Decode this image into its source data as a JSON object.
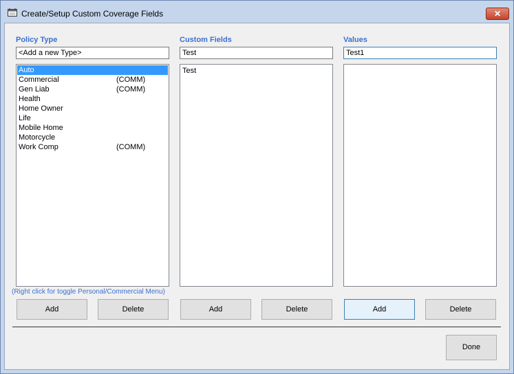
{
  "window": {
    "title": "Create/Setup Custom Coverage Fields",
    "close_glyph": "✕"
  },
  "policy_type": {
    "heading": "Policy Type",
    "input_value": "<Add a new Type>",
    "items": [
      {
        "name": "Auto",
        "tag": "",
        "selected": true
      },
      {
        "name": "Commercial",
        "tag": "(COMM)"
      },
      {
        "name": "Gen Liab",
        "tag": "(COMM)"
      },
      {
        "name": "Health",
        "tag": ""
      },
      {
        "name": "Home Owner",
        "tag": ""
      },
      {
        "name": "Life",
        "tag": ""
      },
      {
        "name": "Mobile Home",
        "tag": ""
      },
      {
        "name": "Motorcycle",
        "tag": ""
      },
      {
        "name": "Work Comp",
        "tag": "(COMM)"
      }
    ],
    "hint": "(Right click for toggle Personal/Commercial Menu)",
    "add_label": "Add",
    "delete_label": "Delete"
  },
  "custom_fields": {
    "heading": "Custom Fields",
    "input_value": "Test",
    "items": [
      "Test"
    ],
    "add_label": "Add",
    "delete_label": "Delete"
  },
  "values": {
    "heading": "Values",
    "input_value": "Test1",
    "items": [],
    "add_label": "Add",
    "delete_label": "Delete"
  },
  "done_label": "Done",
  "icons": {
    "window_icon": "calendar-form-icon"
  }
}
